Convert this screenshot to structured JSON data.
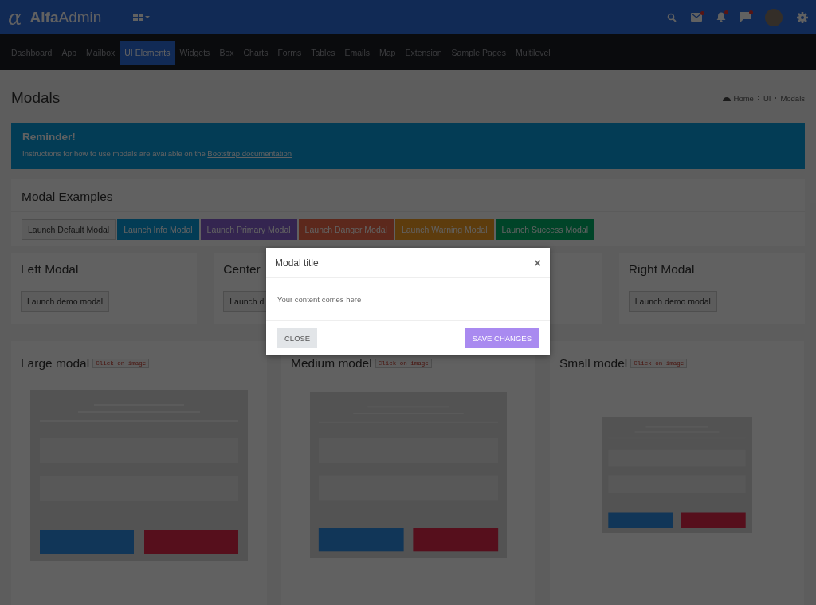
{
  "header": {
    "logo_mark": "α",
    "brand": "**Alfa**Admin"
  },
  "nav": [
    {
      "label": "Dashboard",
      "selected": false
    },
    {
      "label": "App",
      "selected": false
    },
    {
      "label": "Mailbox",
      "selected": false
    },
    {
      "label": "UI Elements",
      "selected": true
    },
    {
      "label": "Widgets",
      "selected": false
    },
    {
      "label": "Box",
      "selected": false
    },
    {
      "label": "Charts",
      "selected": false
    },
    {
      "label": "Forms",
      "selected": false
    },
    {
      "label": "Tables",
      "selected": false
    },
    {
      "label": "Emails",
      "selected": false
    },
    {
      "label": "Map",
      "selected": false
    },
    {
      "label": "Extension",
      "selected": false
    },
    {
      "label": "Sample Pages",
      "selected": false
    },
    {
      "label": "Multilevel",
      "selected": false
    }
  ],
  "page_title": "Modals",
  "breadcrumb": [
    "Home",
    "UI",
    "Modals"
  ],
  "alert": {
    "title": "Reminder!",
    "text": "Instructions for how to use modals are available on the ",
    "link": "Bootstrap documentation"
  },
  "examples": {
    "title": "Modal Examples",
    "buttons": [
      {
        "label": "Launch Default Modal",
        "kind": "default"
      },
      {
        "label": "Launch Info Modal",
        "kind": "info"
      },
      {
        "label": "Launch Primary Modal",
        "kind": "primary"
      },
      {
        "label": "Launch Danger Modal",
        "kind": "danger"
      },
      {
        "label": "Launch Warning Modal",
        "kind": "warning"
      },
      {
        "label": "Launch Success Modal",
        "kind": "success"
      }
    ]
  },
  "position_cards": [
    {
      "title": "Left Modal",
      "button": "Launch demo modal"
    },
    {
      "title": "Center",
      "button": "Launch d"
    },
    {
      "title": "Right Modal",
      "button": "Launch demo modal"
    }
  ],
  "size_cards": [
    {
      "title": "Large modal",
      "hint": "Click on image",
      "kind": "large"
    },
    {
      "title": "Medium model",
      "hint": "Click on image",
      "kind": "medium"
    },
    {
      "title": "Small model",
      "hint": "Click on image",
      "kind": "small"
    }
  ],
  "modal": {
    "title": "Modal title",
    "close": "×",
    "body": "Your content comes here",
    "buttons": [
      {
        "label": "CLOSE",
        "kind": "secondary"
      },
      {
        "label": "SAVE CHANGES",
        "kind": "primary"
      }
    ]
  }
}
